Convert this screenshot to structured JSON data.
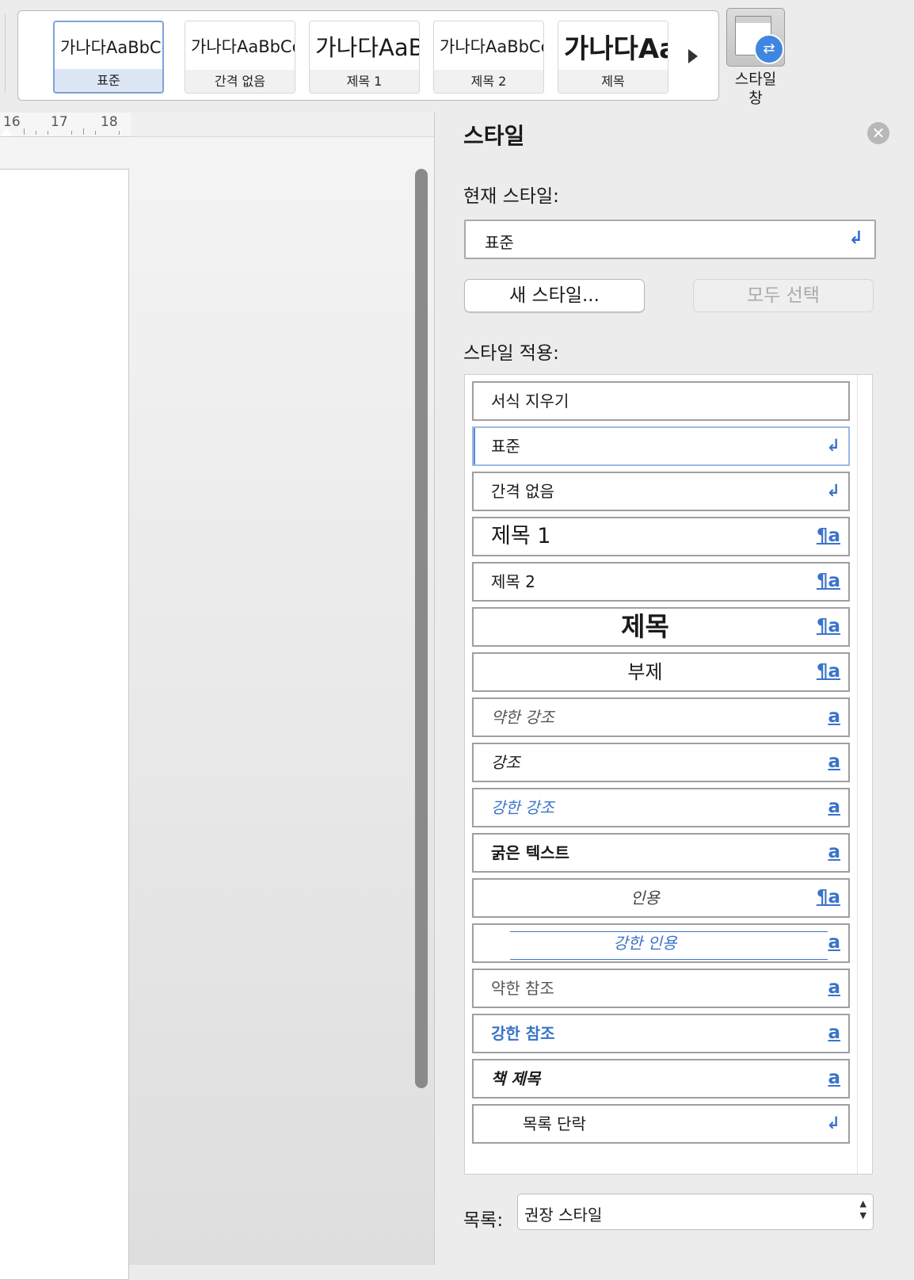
{
  "ribbon": {
    "gallery": [
      {
        "preview": "가나다AaBbCc",
        "caption": "표준",
        "selected": true
      },
      {
        "preview": "가나다AaBbCc",
        "caption": "간격 없음"
      },
      {
        "preview": "가나다AaB",
        "caption": "제목 1"
      },
      {
        "preview": "가나다AaBbCc",
        "caption": "제목 2"
      },
      {
        "preview": "가나다Aa",
        "caption": "제목"
      }
    ],
    "style_pane_button": {
      "line1": "스타일",
      "line2": "창"
    }
  },
  "ruler": {
    "numbers": [
      "16",
      "17",
      "18"
    ]
  },
  "panel": {
    "title": "스타일",
    "current_label": "현재 스타일:",
    "current_value": "표준",
    "new_style_button": "새 스타일...",
    "select_all_button": "모두 선택",
    "apply_label": "스타일 적용:",
    "styles": [
      {
        "name": "서식 지우기",
        "mark": ""
      },
      {
        "name": "표준",
        "mark": "↲",
        "selected": true
      },
      {
        "name": "간격 없음",
        "mark": "↲"
      },
      {
        "name": "제목 1",
        "mark": "¶a"
      },
      {
        "name": "제목 2",
        "mark": "¶a"
      },
      {
        "name": "제목",
        "mark": "¶a"
      },
      {
        "name": "부제",
        "mark": "¶a"
      },
      {
        "name": "약한 강조",
        "mark": "a"
      },
      {
        "name": "강조",
        "mark": "a"
      },
      {
        "name": "강한 강조",
        "mark": "a"
      },
      {
        "name": "굵은 텍스트",
        "mark": "a"
      },
      {
        "name": "인용",
        "mark": "¶a"
      },
      {
        "name": "강한 인용",
        "mark": "a"
      },
      {
        "name": "약한 참조",
        "mark": "a"
      },
      {
        "name": "강한 참조",
        "mark": "a"
      },
      {
        "name": "책 제목",
        "mark": "a"
      },
      {
        "name": "목록 단락",
        "mark": "↲"
      }
    ],
    "list_label": "목록:",
    "list_value": "권장 스타일"
  },
  "colors": {
    "accent": "#3b73c9",
    "selection": "#7ea2d6"
  }
}
